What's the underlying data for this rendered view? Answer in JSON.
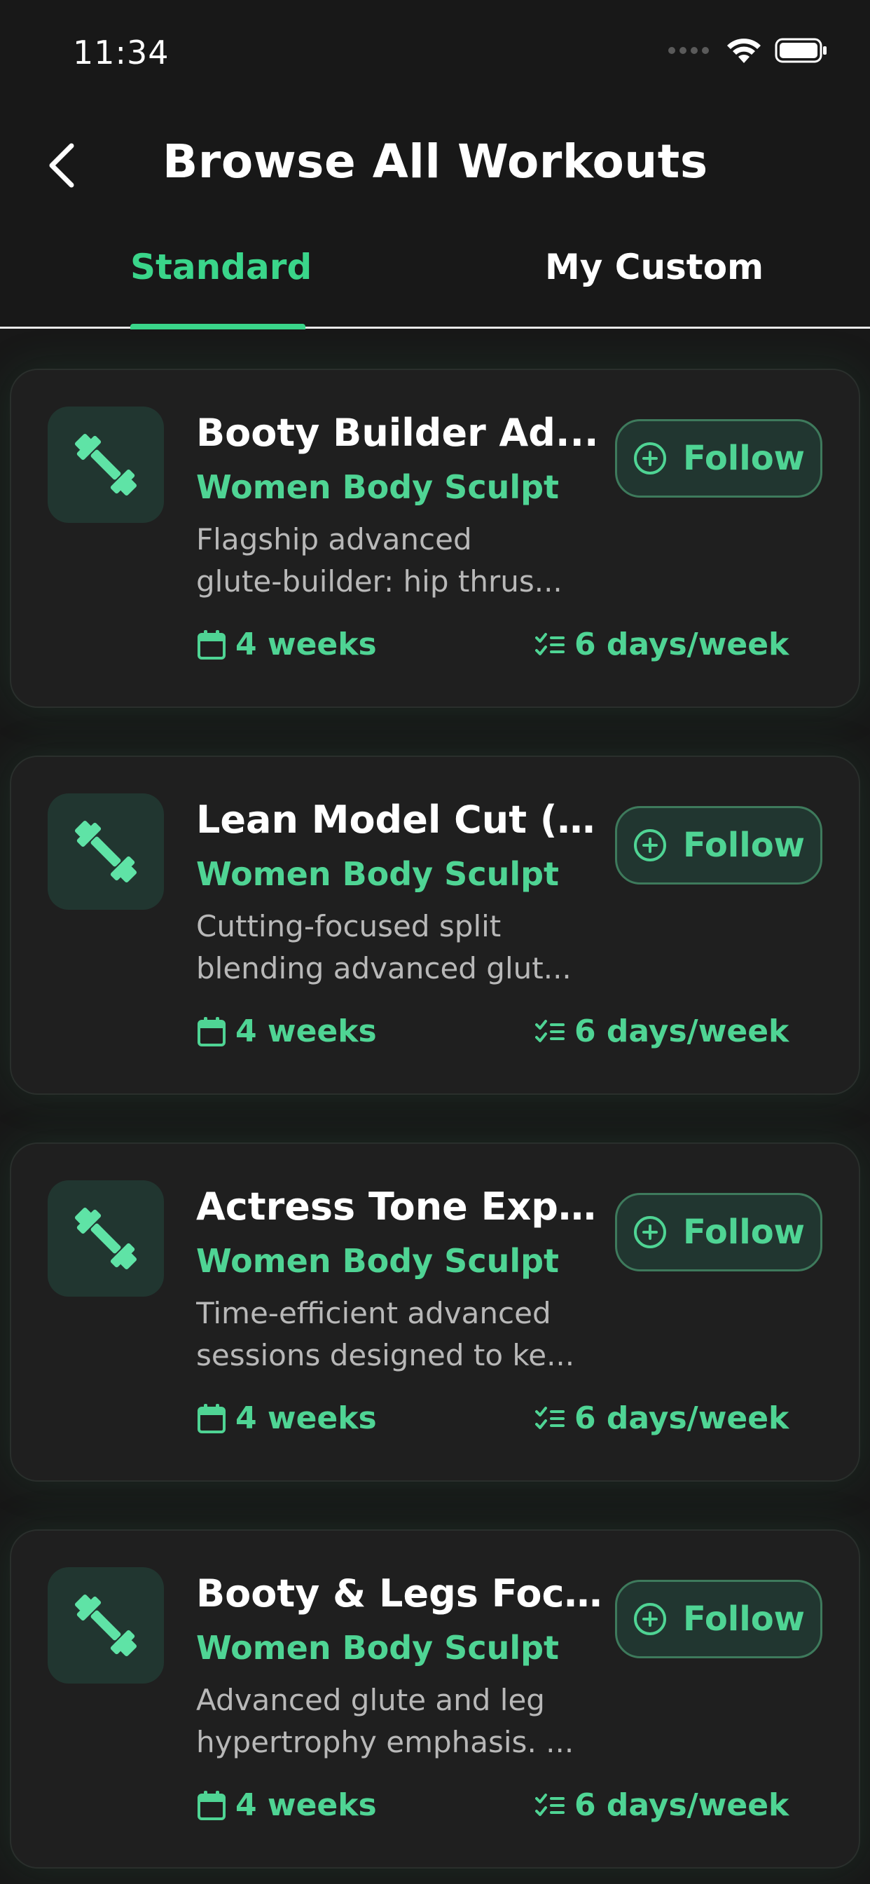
{
  "status_bar": {
    "time": "11:34"
  },
  "header": {
    "title": "Browse All Workouts",
    "back_icon": "chevron-left-icon"
  },
  "tabs": [
    {
      "label": "Standard",
      "active": true
    },
    {
      "label": "My Custom",
      "active": false
    }
  ],
  "colors": {
    "accent": "#3ad58a",
    "accent_text": "#4fd494",
    "card_bg": "#1f1f1f",
    "icon_bg": "#213630",
    "background": "#181818"
  },
  "workouts": [
    {
      "title": "Booty Builder Ad...",
      "category": "Women Body Sculpt",
      "desc_line1": "Flagship advanced",
      "desc_line2": "glute-builder: hip thrus...",
      "duration": "4 weeks",
      "frequency": "6 days/week",
      "follow_label": "Follow",
      "icon": "dumbbell-icon"
    },
    {
      "title": "Lean Model Cut (F...",
      "category": "Women Body Sculpt",
      "desc_line1": "Cutting-focused split",
      "desc_line2": "blending advanced glut...",
      "duration": "4 weeks",
      "frequency": "6 days/week",
      "follow_label": "Follow",
      "icon": "dumbbell-icon"
    },
    {
      "title": "Actress Tone Expr...",
      "category": "Women Body Sculpt",
      "desc_line1": "Time-efficient advanced",
      "desc_line2": "sessions designed to ke...",
      "duration": "4 weeks",
      "frequency": "6 days/week",
      "follow_label": "Follow",
      "icon": "dumbbell-icon"
    },
    {
      "title": "Booty & Legs Foc...",
      "category": "Women Body Sculpt",
      "desc_line1": "Advanced glute and leg",
      "desc_line2": "hypertrophy emphasis. ...",
      "duration": "4 weeks",
      "frequency": "6 days/week",
      "follow_label": "Follow",
      "icon": "dumbbell-icon"
    }
  ]
}
